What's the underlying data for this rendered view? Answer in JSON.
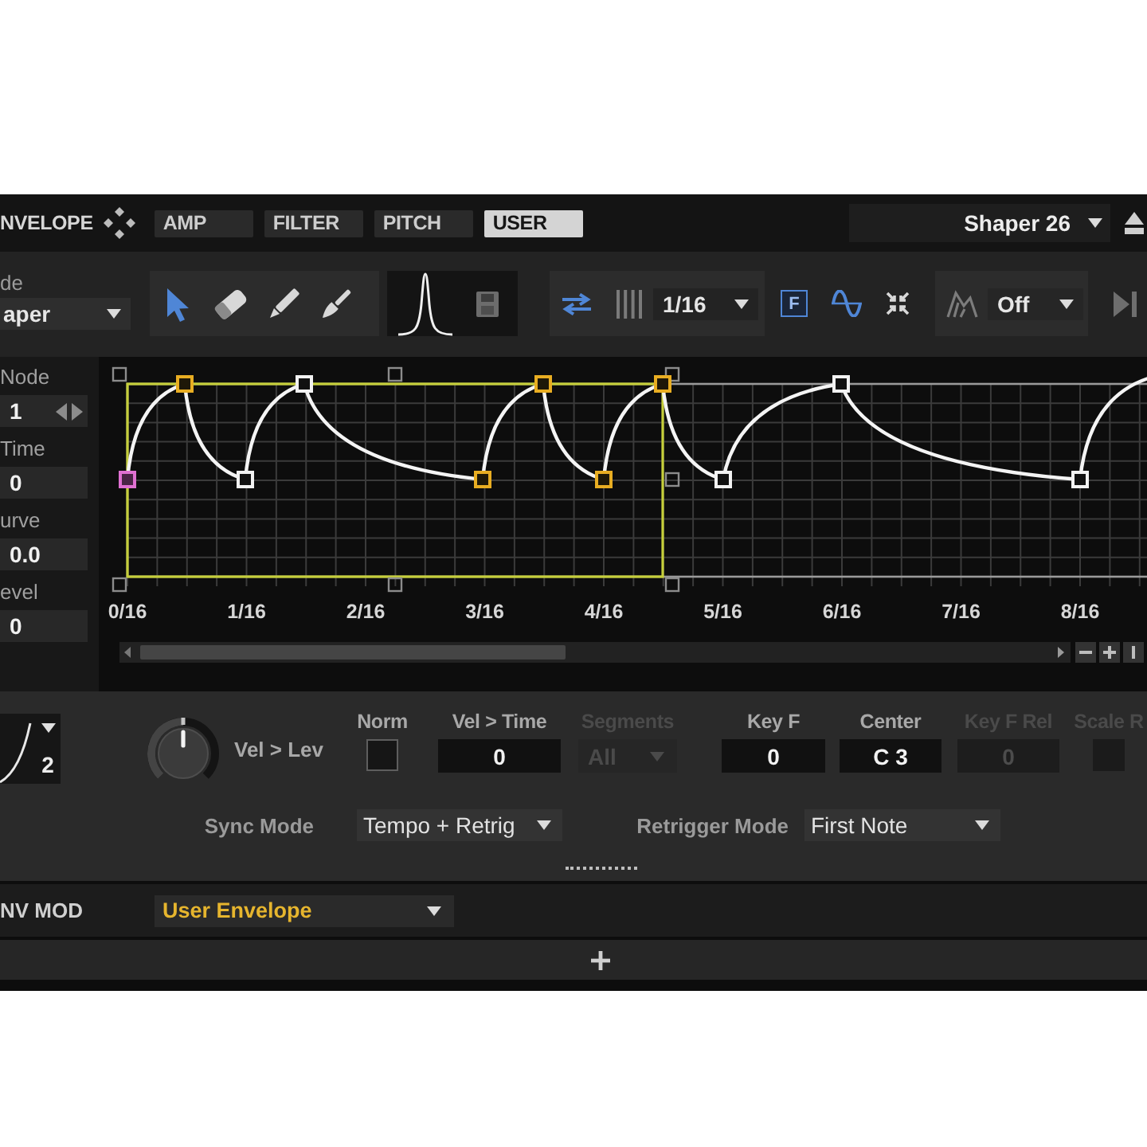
{
  "header": {
    "title": "NVELOPE",
    "tabs": [
      {
        "label": "AMP",
        "selected": false
      },
      {
        "label": "FILTER",
        "selected": false
      },
      {
        "label": "PITCH",
        "selected": false
      },
      {
        "label": "USER",
        "selected": true
      }
    ],
    "preset": "Shaper 26"
  },
  "toolbar": {
    "mode_label": "de",
    "mode": "aper",
    "tools": [
      {
        "kind": "pointer",
        "selected": true
      },
      {
        "kind": "eraser",
        "selected": false
      },
      {
        "kind": "pencil",
        "selected": false
      },
      {
        "kind": "brush",
        "selected": false
      }
    ],
    "sync": {
      "on": true
    },
    "grid": "1/16",
    "snap_buttons": [
      {
        "kind": "letter",
        "label": "F",
        "on": true
      },
      {
        "kind": "wave",
        "on": true
      },
      {
        "kind": "collapse",
        "on": false
      }
    ],
    "shape": "Off"
  },
  "parameters": [
    {
      "kind": "stepper",
      "label": "Node",
      "value": "1"
    },
    {
      "kind": "field",
      "label": "Time",
      "value": "0"
    },
    {
      "kind": "field",
      "label": "urve",
      "value": "0.0"
    },
    {
      "kind": "field",
      "label": "evel",
      "value": "0"
    }
  ],
  "editor": {
    "nodes": [
      {
        "selected": true,
        "focused": true
      },
      {
        "selected": true,
        "focused": false
      },
      {
        "selected": false,
        "focused": false
      },
      {
        "selected": false,
        "focused": false
      },
      {
        "selected": true,
        "focused": false
      },
      {
        "selected": true,
        "focused": false
      },
      {
        "selected": true,
        "focused": false
      },
      {
        "selected": true,
        "focused": false
      },
      {
        "selected": false,
        "focused": false
      },
      {
        "selected": false,
        "focused": false
      },
      {
        "selected": false,
        "focused": false
      }
    ],
    "time_labels": [
      "0/16",
      "1/16",
      "2/16",
      "3/16",
      "4/16",
      "5/16",
      "6/16",
      "7/16",
      "8/16"
    ]
  },
  "velocity": {
    "curve": "2",
    "knob": {
      "label": "Vel > Lev",
      "level": 0.5
    }
  },
  "controls": [
    {
      "kind": "checkbox",
      "label": "Norm",
      "checked": false,
      "disabled": false
    },
    {
      "kind": "field",
      "label": "Vel > Time",
      "value": "0",
      "disabled": false
    },
    {
      "kind": "dropdown",
      "label": "Segments",
      "value": "All",
      "disabled": true
    },
    {
      "kind": "field",
      "label": "Key F",
      "value": "0",
      "disabled": false
    },
    {
      "kind": "field",
      "label": "Center",
      "value": "C 3",
      "disabled": false
    },
    {
      "kind": "field",
      "label": "Key F Rel",
      "value": "0",
      "disabled": true
    },
    {
      "kind": "checkbox",
      "label": "Scale R",
      "checked": false,
      "disabled": true
    }
  ],
  "mode_settings": [
    {
      "label": "Sync Mode",
      "value": "Tempo + Retrig"
    },
    {
      "label": "Retrigger Mode",
      "value": "First Note"
    }
  ],
  "env_mod": {
    "label": "NV MOD",
    "value": "User Envelope"
  }
}
